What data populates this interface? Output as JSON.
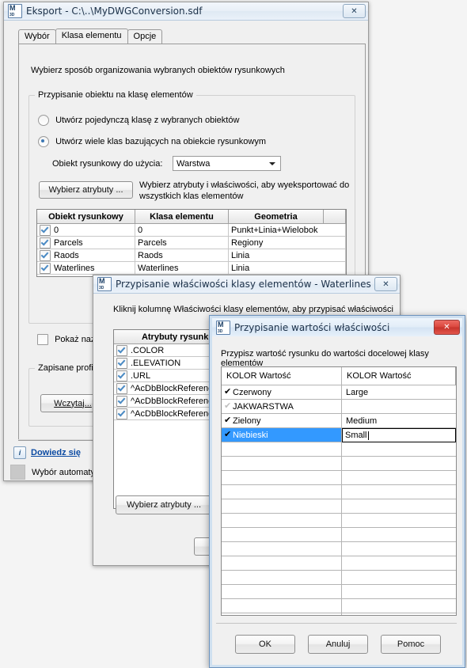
{
  "export_dialog": {
    "title": "Eksport - C:\\..\\MyDWGConversion.sdf",
    "icon": "map3d-icon",
    "close_label": "✕",
    "tabs": [
      {
        "label": "Wybór",
        "active": false
      },
      {
        "label": "Klasa elementu",
        "active": true
      },
      {
        "label": "Opcje",
        "active": false
      }
    ],
    "intro_text": "Wybierz sposób organizowania wybranych obiektów rysunkowych",
    "group_assign": {
      "legend": "Przypisanie obiektu na klasę elementów",
      "radio_single": {
        "label": "Utwórz pojedynczą klasę z wybranych obiektów",
        "selected": false
      },
      "radio_multi": {
        "label": "Utwórz wiele klas bazujących na obiekcie rysunkowym",
        "selected": true
      },
      "drawing_object_label": "Obiekt rysunkowy do użycia:",
      "drawing_object_value": "Warstwa",
      "select_attributes_button": "Wybierz atrybuty ...",
      "attributes_hint_line1": "Wybierz atrybuty i właściwości, aby wyeksportować do",
      "attributes_hint_line2": "wszystkich klas elementów",
      "grid": {
        "columns": [
          "Obiekt rysunkowy",
          "Klasa elementu",
          "Geometria"
        ],
        "rows": [
          {
            "checked": true,
            "object": "0",
            "feature_class": "0",
            "geometry": "Punkt+Linia+Wielobok"
          },
          {
            "checked": true,
            "object": "Parcels",
            "feature_class": "Parcels",
            "geometry": "Regiony"
          },
          {
            "checked": true,
            "object": "Raods",
            "feature_class": "Raods",
            "geometry": "Linia"
          },
          {
            "checked": true,
            "object": "Waterlines",
            "feature_class": "Waterlines",
            "geometry": "Linia"
          }
        ]
      },
      "show_names_checkbox": {
        "label": "Pokaż nazw",
        "checked": false
      }
    },
    "group_profiles": {
      "legend": "Zapisane profile",
      "load_button": "Wczytaj..."
    },
    "learn_more_link": "Dowiedz się",
    "info_icon": "info-icon",
    "auto_select_label": "Wybór automaty"
  },
  "properties_dialog": {
    "title": "Przypisanie właściwości klasy elementów - Waterlines",
    "icon": "map3d-icon",
    "close_label": "✕",
    "intro_text": "Kliknij kolumnę Właściwości klasy elementów, aby przypisać właściwości",
    "grid": {
      "columns": [
        "Atrybuty rysunku"
      ],
      "rows": [
        {
          "checked": true,
          "attribute": ".COLOR"
        },
        {
          "checked": true,
          "attribute": ".ELEVATION"
        },
        {
          "checked": true,
          "attribute": ".URL"
        },
        {
          "checked": true,
          "attribute": "^AcDbBlockReference"
        },
        {
          "checked": true,
          "attribute": "^AcDbBlockReference"
        },
        {
          "checked": true,
          "attribute": "^AcDbBlockReference"
        }
      ]
    },
    "select_attributes_button": "Wybierz atrybuty ..."
  },
  "values_dialog": {
    "title": "Przypisanie wartości właściwości",
    "icon": "map3d-icon",
    "close_label": "✕",
    "intro_text": "Przypisz wartość rysunku do wartości docelowej klasy elementów",
    "grid": {
      "columns": [
        "KOLOR Wartość",
        "KOLOR Wartość"
      ],
      "rows": [
        {
          "checked": true,
          "source": "Czerwony",
          "target": "Large",
          "selected": false,
          "editing": false
        },
        {
          "checked": false,
          "source": "JAKWARSTWA",
          "target": "",
          "selected": false,
          "editing": false
        },
        {
          "checked": true,
          "source": "Zielony",
          "target": "Medium",
          "selected": false,
          "editing": false
        },
        {
          "checked": true,
          "source": "Niebieski",
          "target": "Small",
          "selected": true,
          "editing": true
        }
      ],
      "empty_row_count": 13
    },
    "buttons": {
      "ok": "OK",
      "cancel": "Anuluj",
      "help": "Pomoc"
    }
  },
  "colors": {
    "selection_blue": "#3399ff",
    "link_blue": "#0b4aa2",
    "window_face": "#f0f0f0",
    "desktop": "#f4f4f4"
  }
}
